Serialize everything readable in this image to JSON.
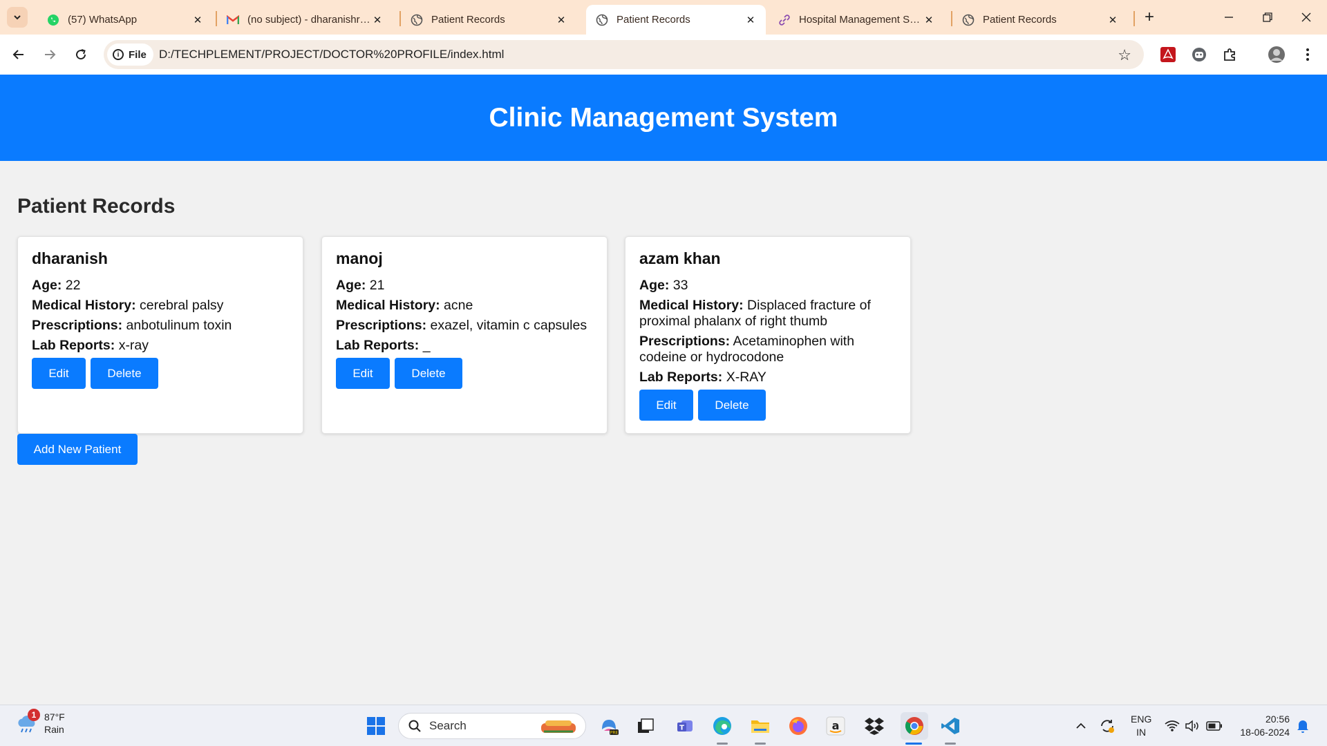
{
  "browser": {
    "tabs": [
      {
        "title": "(57) WhatsApp",
        "favicon": "whatsapp-icon",
        "active": false
      },
      {
        "title": "(no subject) - dharanishrav",
        "favicon": "gmail-icon",
        "active": false
      },
      {
        "title": "Patient Records",
        "favicon": "globe-icon",
        "active": false
      },
      {
        "title": "Patient Records",
        "favicon": "globe-icon",
        "active": true
      },
      {
        "title": "Hospital Management Syst",
        "favicon": "link-icon",
        "active": false
      },
      {
        "title": "Patient Records",
        "favicon": "globe-icon",
        "active": false
      }
    ],
    "scheme_label": "File",
    "url": "D:/TECHPLEMENT/PROJECT/DOCTOR%20PROFILE/index.html"
  },
  "page": {
    "header_title": "Clinic Management System",
    "section_title": "Patient Records",
    "labels": {
      "age": "Age:",
      "medical_history": "Medical History:",
      "prescriptions": "Prescriptions:",
      "lab_reports": "Lab Reports:"
    },
    "edit_label": "Edit",
    "delete_label": "Delete",
    "add_label": "Add New Patient",
    "patients": [
      {
        "name": "dharanish",
        "age": "22",
        "medical_history": "cerebral palsy",
        "prescriptions": "anbotulinum toxin",
        "lab_reports": "x-ray"
      },
      {
        "name": "manoj",
        "age": "21",
        "medical_history": "acne",
        "prescriptions": "exazel, vitamin c capsules",
        "lab_reports": "_"
      },
      {
        "name": "azam khan",
        "age": "33",
        "medical_history": "Displaced fracture of proximal phalanx of right thumb",
        "prescriptions": "Acetaminophen with codeine or hydrocodone",
        "lab_reports": "X-RAY"
      }
    ]
  },
  "taskbar": {
    "weather_temp": "87°F",
    "weather_desc": "Rain",
    "weather_badge": "1",
    "search_label": "Search",
    "lang_line1": "ENG",
    "lang_line2": "IN",
    "time": "20:56",
    "date": "18-06-2024"
  },
  "colors": {
    "header_blue": "#0a7bff",
    "tabstrip": "#fde6d2",
    "page_bg": "#f1f1f1"
  }
}
